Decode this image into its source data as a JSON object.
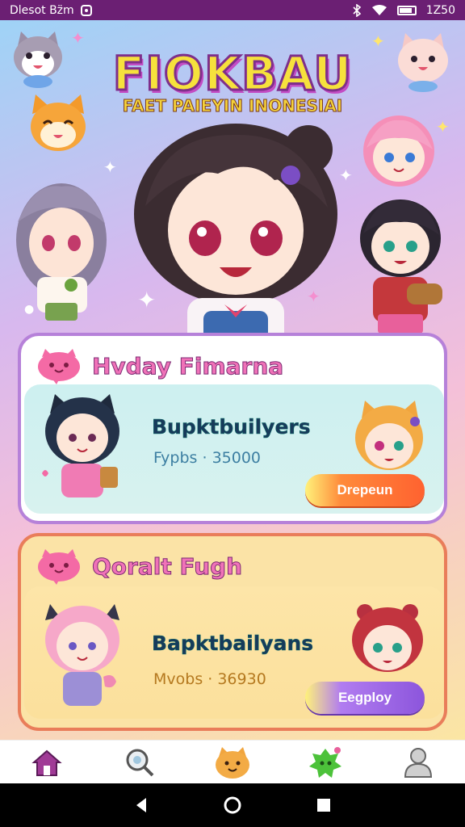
{
  "status_bar": {
    "left_text": "Dlesot Bz̈m",
    "time": "1Z50"
  },
  "hero": {
    "app_title": "FIOKBAU",
    "subtitle": "FAET PAIEYIN INONESIAI"
  },
  "sections": [
    {
      "title": "Hvday Fimarna",
      "card": {
        "title": "Bupktbuilyers",
        "meta": "Fypbs · 35000",
        "button_label": "Drepeun"
      }
    },
    {
      "title": "Qoralt Fugh",
      "card": {
        "title": "Bapktbailyans",
        "meta": "Mvobs · 36930",
        "button_label": "Eegploy"
      }
    }
  ],
  "bottom_nav": [
    {
      "icon": "home-icon",
      "active": true
    },
    {
      "icon": "search-icon",
      "active": false
    },
    {
      "icon": "mascot-icon",
      "active": false
    },
    {
      "icon": "monster-icon",
      "active": false
    },
    {
      "icon": "profile-icon",
      "active": false
    }
  ],
  "colors": {
    "status_bar": "#6b1f73",
    "accent_pink": "#f072b8",
    "button_orange": "#ff6230",
    "button_purple": "#8c55dc",
    "nav_active": "#7b2b7e"
  }
}
